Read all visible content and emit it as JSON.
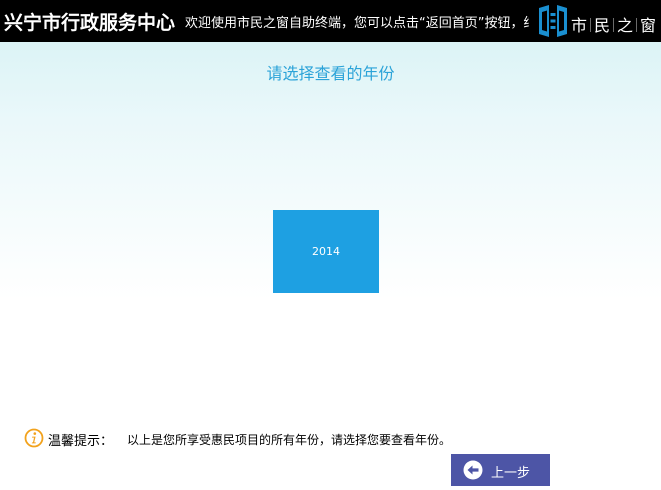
{
  "header": {
    "title": "兴宁市行政服务中心",
    "marquee": "欢迎使用市民之窗自助终端，您可以点击“返回首页”按钮，结",
    "logo_text": [
      "市",
      "民",
      "之",
      "窗"
    ],
    "logo_icon": "shimin-zhichuang-logo-icon"
  },
  "main": {
    "title": "请选择查看的年份",
    "years": [
      "2014"
    ]
  },
  "tip": {
    "icon": "info-icon",
    "label": "温馨提示：",
    "text": "以上是您所享受惠民项目的所有年份，请选择您要查看年份。"
  },
  "footer": {
    "back_label": "上一步",
    "back_icon": "arrow-left-circle-icon"
  },
  "colors": {
    "header_bg": "#000000",
    "title_text": "#2ba3d8",
    "tile_bg": "#1ea0e2",
    "button_bg": "#4d55a6",
    "logo_accent": "#1a8fd0",
    "tip_icon": "#f2a21c"
  }
}
